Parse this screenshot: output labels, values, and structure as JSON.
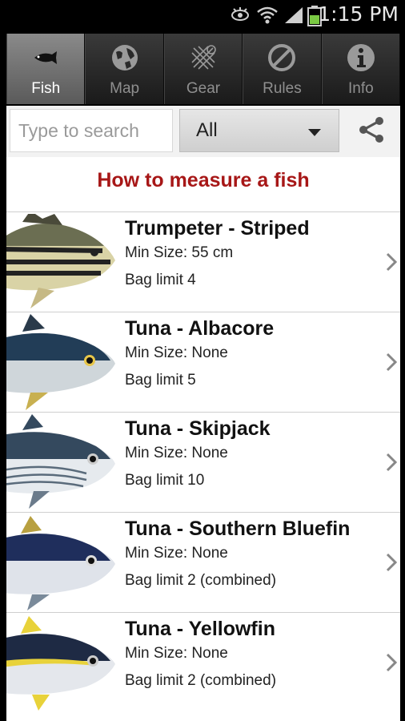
{
  "status_bar": {
    "time": "1:15 PM",
    "icons": [
      "eye-icon",
      "wifi-icon",
      "signal-icon",
      "battery-icon"
    ]
  },
  "tabs": [
    {
      "label": "Fish",
      "icon": "fish-icon",
      "active": true
    },
    {
      "label": "Map",
      "icon": "globe-icon",
      "active": false
    },
    {
      "label": "Gear",
      "icon": "net-icon",
      "active": false
    },
    {
      "label": "Rules",
      "icon": "no-entry-icon",
      "active": false
    },
    {
      "label": "Info",
      "icon": "info-icon",
      "active": false
    }
  ],
  "search": {
    "placeholder": "Type to search",
    "value": ""
  },
  "filter": {
    "selected": "All"
  },
  "share_icon": "share-icon",
  "measure_link": "How to measure a fish",
  "colors": {
    "link_red": "#a71717",
    "active_tab": "#707070"
  },
  "fish": [
    {
      "name": "Trumpeter - Striped",
      "min_size": "Min Size: 55 cm",
      "bag": "Bag limit 4",
      "type": "trumpeter"
    },
    {
      "name": "Tuna - Albacore",
      "min_size": "Min Size: None",
      "bag": "Bag limit 5",
      "type": "albacore"
    },
    {
      "name": "Tuna - Skipjack",
      "min_size": "Min Size: None",
      "bag": "Bag limit 10",
      "type": "skipjack"
    },
    {
      "name": "Tuna - Southern Bluefin",
      "min_size": "Min Size: None",
      "bag": "Bag limit 2 (combined)",
      "type": "bluefin"
    },
    {
      "name": "Tuna - Yellowfin",
      "min_size": "Min Size: None",
      "bag": "Bag limit 2 (combined)",
      "type": "yellowfin"
    }
  ]
}
